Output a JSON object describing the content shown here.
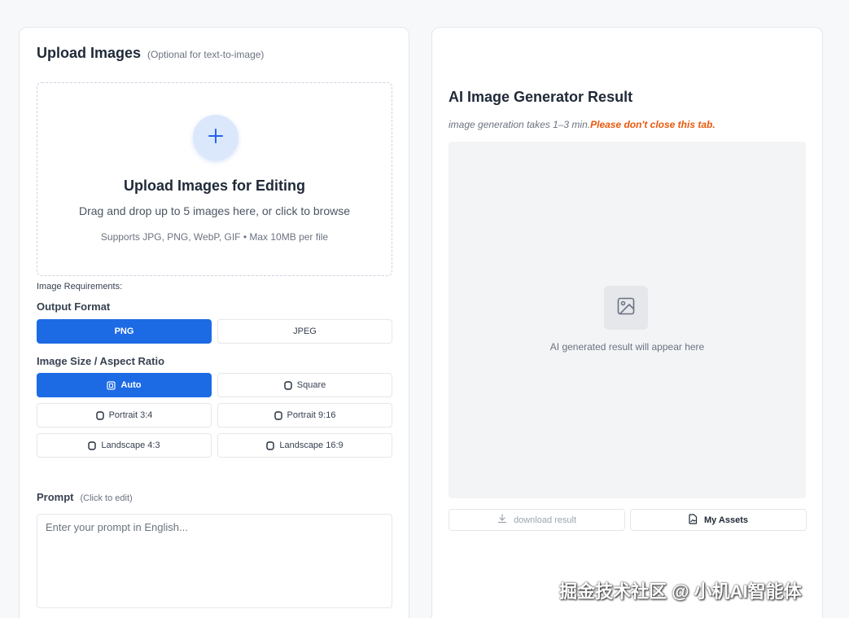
{
  "upload": {
    "title": "Upload Images",
    "subtitle": "(Optional for text-to-image)",
    "dropzone": {
      "icon": "plus-icon",
      "title": "Upload Images for Editing",
      "description": "Drag and drop up to 5 images here, or click to browse",
      "note": "Supports JPG, PNG, WebP, GIF  •  Max 10MB per file"
    },
    "requirements_label": "Image Requirements:"
  },
  "output_format": {
    "label": "Output Format",
    "options": [
      "PNG",
      "JPEG"
    ],
    "selected": "PNG"
  },
  "image_size": {
    "label": "Image Size / Aspect Ratio",
    "options": [
      "Auto",
      "Square",
      "Portrait 3:4",
      "Portrait 9:16",
      "Landscape 4:3",
      "Landscape 16:9"
    ],
    "selected": "Auto"
  },
  "prompt": {
    "label": "Prompt",
    "hint": "(Click to edit)",
    "placeholder": "Enter your prompt in English...",
    "value": ""
  },
  "result": {
    "title": "AI Image Generator Result",
    "note_plain": "image generation takes 1–3 min.",
    "note_warning": "Please don't close this tab.",
    "placeholder_icon": "image-icon",
    "placeholder_text": "AI generated result will appear here",
    "download_label": "download result",
    "assets_label": "My Assets"
  },
  "watermark": "掘金技术社区 @ 小机AI智能体",
  "colors": {
    "accent": "#1d6ae5",
    "warning": "#ea580c",
    "page_background": "#f7f8fa"
  }
}
